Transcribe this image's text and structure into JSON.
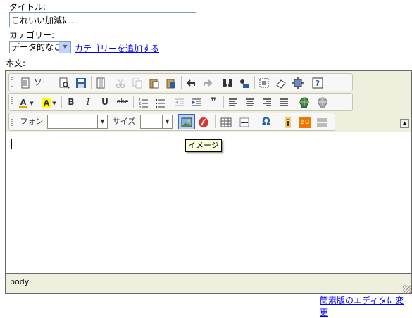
{
  "form": {
    "title_label": "タイトル:",
    "title_value": "これいい加減に…",
    "category_label": "カテゴリー:",
    "category_selected": "データ的なこと",
    "add_category_link": "カテゴリーを追加する",
    "body_label": "本文:"
  },
  "toolbar": {
    "row1": [
      {
        "name": "source-button",
        "label": "ソース",
        "icon": "page-icon"
      },
      {
        "name": "preview-button",
        "icon": "preview-icon"
      },
      {
        "name": "save-button",
        "icon": "disk-icon"
      },
      {
        "name": "templates-button",
        "icon": "templates-icon"
      },
      {
        "name": "cut-button",
        "icon": "scissors-icon"
      },
      {
        "name": "copy-button",
        "icon": "copy-icon"
      },
      {
        "name": "paste-button",
        "icon": "clipboard-icon"
      },
      {
        "name": "paste-word-button",
        "icon": "paste-word-icon"
      },
      {
        "name": "undo-button",
        "icon": "undo-icon"
      },
      {
        "name": "redo-button",
        "icon": "redo-icon"
      },
      {
        "name": "find-button",
        "icon": "binoculars-icon"
      },
      {
        "name": "replace-button",
        "icon": "replace-icon"
      },
      {
        "name": "select-all-button",
        "icon": "select-all-icon"
      },
      {
        "name": "remove-format-button",
        "icon": "eraser-icon"
      },
      {
        "name": "maximize-button",
        "icon": "maximize-icon"
      },
      {
        "name": "about-button",
        "icon": "question-icon"
      }
    ],
    "row2": [
      {
        "name": "text-color-button",
        "icon": "text-color-icon"
      },
      {
        "name": "bg-color-button",
        "icon": "highlight-icon"
      },
      {
        "name": "bold-button",
        "label": "B"
      },
      {
        "name": "italic-button",
        "label": "I"
      },
      {
        "name": "underline-button",
        "label": "U"
      },
      {
        "name": "strike-button",
        "label": "abc"
      },
      {
        "name": "ordered-list-button",
        "icon": "numbered-list-icon"
      },
      {
        "name": "unordered-list-button",
        "icon": "bullet-list-icon"
      },
      {
        "name": "outdent-button",
        "icon": "outdent-icon"
      },
      {
        "name": "indent-button",
        "icon": "indent-icon"
      },
      {
        "name": "blockquote-button",
        "label": "❞"
      },
      {
        "name": "align-left-button",
        "icon": "align-left-icon"
      },
      {
        "name": "align-center-button",
        "icon": "align-center-icon"
      },
      {
        "name": "align-right-button",
        "icon": "align-right-icon"
      },
      {
        "name": "align-justify-button",
        "icon": "align-justify-icon"
      },
      {
        "name": "link-button",
        "icon": "globe-link-icon"
      },
      {
        "name": "unlink-button",
        "icon": "globe-unlink-icon"
      }
    ],
    "font_label": "フォント",
    "size_label": "サイズ",
    "row3": [
      {
        "name": "image-button",
        "icon": "image-icon"
      },
      {
        "name": "flash-button",
        "icon": "flash-icon"
      },
      {
        "name": "table-button",
        "icon": "table-icon"
      },
      {
        "name": "rule-button",
        "icon": "horizontal-rule-icon"
      },
      {
        "name": "special-char-button",
        "label": "Ω"
      },
      {
        "name": "emoji-i-button",
        "icon": "imode-icon"
      },
      {
        "name": "emoji-au-button",
        "label": "au"
      },
      {
        "name": "emoji-sb-button",
        "icon": "softbank-icon"
      }
    ]
  },
  "tooltip": "イメージ",
  "status_path": "body",
  "footer_link": "簡素版のエディタに変更",
  "colors": {
    "link": "#0000ff",
    "toolbar_bg": "#efefde",
    "tooltip_bg": "#ffffe1"
  }
}
